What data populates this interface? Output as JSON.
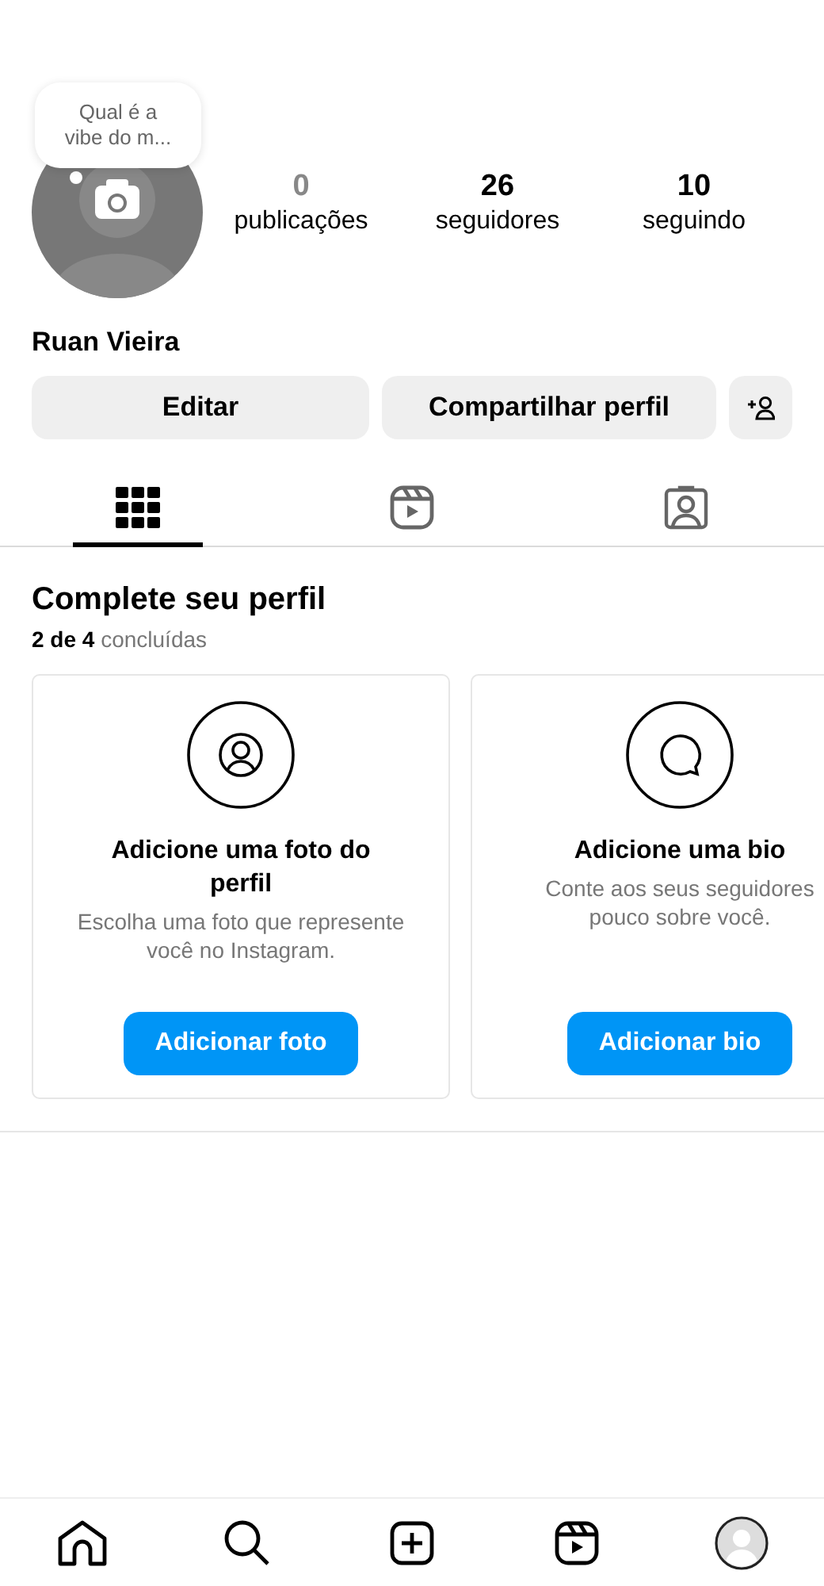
{
  "note": {
    "text": "Qual é a vibe do m..."
  },
  "stats": [
    {
      "value": "0",
      "label": "publicações",
      "dimmed": true
    },
    {
      "value": "26",
      "label": "seguidores",
      "dimmed": false
    },
    {
      "value": "10",
      "label": "seguindo",
      "dimmed": false
    }
  ],
  "name": "Ruan Vieira",
  "buttons": [
    "Editar",
    "Compartilhar perfil"
  ],
  "tabs": [
    {
      "kind": "grid",
      "selected": true
    },
    {
      "kind": "reels",
      "selected": false
    },
    {
      "kind": "tagged",
      "selected": false
    }
  ],
  "complete": {
    "title": "Complete seu perfil",
    "progress": "**2 de 4** concluídas",
    "cards": [
      {
        "title": "Adicione uma foto do perfil",
        "text": "Escolha uma foto que represente você no Instagram.",
        "button": "Adicionar foto"
      },
      {
        "kind": "bio",
        "title": "Adicione uma bio",
        "text": "Conte aos seus seguidores\npouco sobre você.",
        "button": "Adicionar bio"
      }
    ]
  },
  "nav": [
    {
      "kind": "home"
    },
    {
      "kind": "search"
    },
    {
      "kind": "create"
    },
    {
      "kind": "reels"
    },
    {
      "kind": "profile"
    }
  ]
}
